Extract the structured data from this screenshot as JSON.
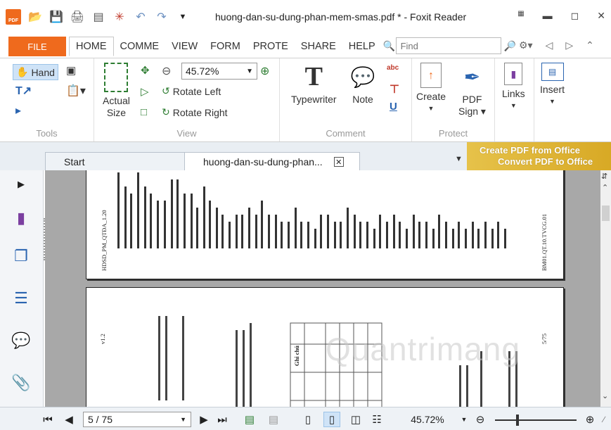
{
  "window": {
    "title": "huong-dan-su-dung-phan-mem-smas.pdf * - Foxit Reader",
    "app_logo_text": "PDF"
  },
  "menu": {
    "file_label": "FILE",
    "tabs": [
      {
        "label": "HOME"
      },
      {
        "label": "COMME"
      },
      {
        "label": "VIEW"
      },
      {
        "label": "FORM"
      },
      {
        "label": "PROTE"
      },
      {
        "label": "SHARE"
      },
      {
        "label": "HELP"
      }
    ],
    "find_placeholder": "Find"
  },
  "ribbon": {
    "tools": {
      "label": "Tools",
      "hand_label": "Hand"
    },
    "view": {
      "label": "View",
      "actual_size_line1": "Actual",
      "actual_size_line2": "Size",
      "zoom_value": "45.72%",
      "rotate_left": "Rotate Left",
      "rotate_right": "Rotate Right"
    },
    "comment": {
      "label": "Comment",
      "typewriter": "Typewriter",
      "note": "Note"
    },
    "protect": {
      "label": "Protect",
      "create": "Create",
      "pdf_sign_line1": "PDF",
      "pdf_sign_line2": "Sign"
    },
    "links": "Links",
    "insert": "Insert"
  },
  "doc_tabs": {
    "start": "Start",
    "active": "huong-dan-su-dung-phan...",
    "promo_line1": "Create PDF from Office",
    "promo_line2": "Convert PDF to Office"
  },
  "document": {
    "page1_footer_left": "HDSD_PM_QTĐA_1.20",
    "page1_footer_right": "BM01.QT.10.TVCG.01",
    "page2_version": "v1.2",
    "page2_right": "5/75",
    "page2_header_cell": "Ghi chú",
    "watermark": "Quantrimang"
  },
  "status": {
    "page_value": "5 / 75",
    "zoom": "45.72%"
  }
}
